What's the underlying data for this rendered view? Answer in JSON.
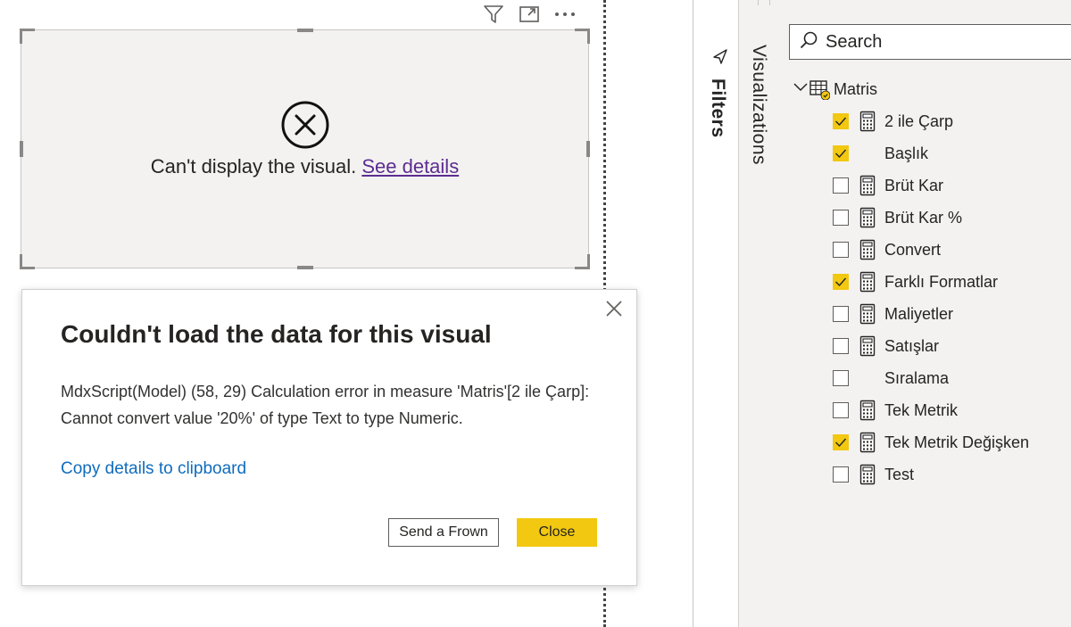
{
  "visual": {
    "error_text": "Can't display the visual.",
    "details_link": "See details"
  },
  "dialog": {
    "title": "Couldn't load the data for this visual",
    "body": "MdxScript(Model) (58, 29) Calculation error in measure 'Matris'[2 ile Çarp]: Cannot convert value '20%' of type Text to type Numeric.",
    "copy_link": "Copy details to clipboard",
    "send_frown_label": "Send a Frown",
    "close_label": "Close"
  },
  "panes": {
    "filters_label": "Filters",
    "visualizations_label": "Visualizations"
  },
  "fields": {
    "search_placeholder": "Search",
    "table_name": "Matris",
    "items": [
      {
        "label": "2 ile Çarp",
        "checked": true,
        "icon": "calculator-icon"
      },
      {
        "label": "Başlık",
        "checked": true,
        "icon": ""
      },
      {
        "label": "Brüt Kar",
        "checked": false,
        "icon": "calculator-icon"
      },
      {
        "label": "Brüt Kar %",
        "checked": false,
        "icon": "calculator-icon"
      },
      {
        "label": "Convert",
        "checked": false,
        "icon": "calculator-icon"
      },
      {
        "label": "Farklı Formatlar",
        "checked": true,
        "icon": "calculator-icon"
      },
      {
        "label": "Maliyetler",
        "checked": false,
        "icon": "calculator-icon"
      },
      {
        "label": "Satışlar",
        "checked": false,
        "icon": "calculator-icon"
      },
      {
        "label": "Sıralama",
        "checked": false,
        "icon": ""
      },
      {
        "label": "Tek Metrik",
        "checked": false,
        "icon": "calculator-icon"
      },
      {
        "label": "Tek Metrik Değişken",
        "checked": true,
        "icon": "calculator-icon"
      },
      {
        "label": "Test",
        "checked": false,
        "icon": "calculator-icon"
      }
    ]
  },
  "colors": {
    "accent_yellow": "#f2c811",
    "link_purple": "#5c2d91",
    "link_blue": "#0f6cbd"
  }
}
